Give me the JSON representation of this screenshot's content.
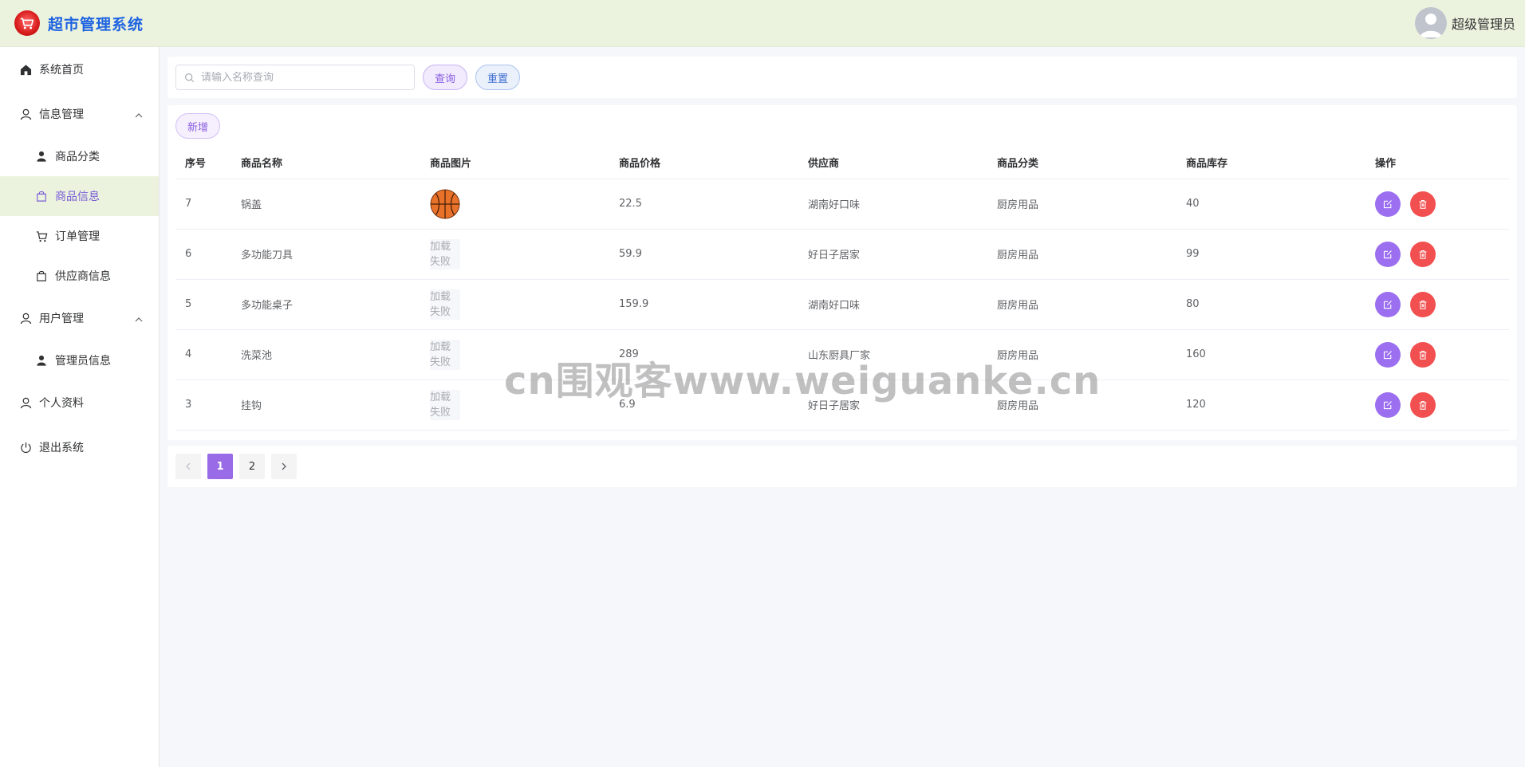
{
  "app": {
    "title": "超市管理系统",
    "user": "超级管理员"
  },
  "sidebar": {
    "home": "系统首页",
    "info_group": "信息管理",
    "info_items": [
      "商品分类",
      "商品信息",
      "订单管理",
      "供应商信息"
    ],
    "user_group": "用户管理",
    "user_items": [
      "管理员信息"
    ],
    "profile": "个人资料",
    "logout": "退出系统"
  },
  "search": {
    "placeholder": "请输入名称查询",
    "query_label": "查询",
    "reset_label": "重置"
  },
  "toolbar": {
    "add_label": "新增"
  },
  "table": {
    "headers": [
      "序号",
      "商品名称",
      "商品图片",
      "商品价格",
      "供应商",
      "商品分类",
      "商品库存",
      "操作"
    ],
    "img_fail_text": "加载失败",
    "rows": [
      {
        "id": "7",
        "name": "锅盖",
        "price": "22.5",
        "supplier": "湖南好口味",
        "category": "厨房用品",
        "stock": "40"
      },
      {
        "id": "6",
        "name": "多功能刀具",
        "price": "59.9",
        "supplier": "好日子居家",
        "category": "厨房用品",
        "stock": "99"
      },
      {
        "id": "5",
        "name": "多功能桌子",
        "price": "159.9",
        "supplier": "湖南好口味",
        "category": "厨房用品",
        "stock": "80"
      },
      {
        "id": "4",
        "name": "洗菜池",
        "price": "289",
        "supplier": "山东厨具厂家",
        "category": "厨房用品",
        "stock": "160"
      },
      {
        "id": "3",
        "name": "挂钩",
        "price": "6.9",
        "supplier": "好日子居家",
        "category": "厨房用品",
        "stock": "120"
      }
    ]
  },
  "pagination": {
    "pages": [
      "1",
      "2"
    ],
    "current": "1"
  },
  "watermark": "cn围观客www.weiguanke.cn",
  "colors": {
    "accent": "#9a6be6",
    "header_bg": "#ebf3df",
    "danger": "#f25050",
    "brand": "#1e63e0"
  }
}
